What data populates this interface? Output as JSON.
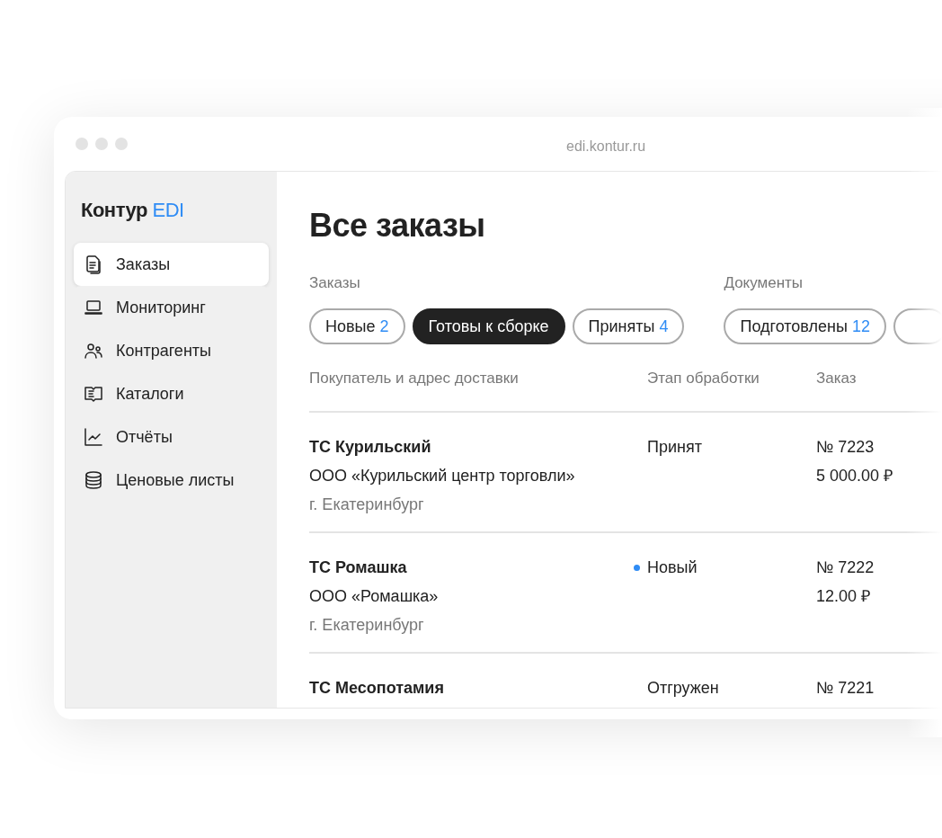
{
  "window": {
    "url": "edi.kontur.ru"
  },
  "sidebar": {
    "logo": {
      "name": "Контур",
      "product": "EDI"
    },
    "items": [
      {
        "label": "Заказы",
        "selected": true
      },
      {
        "label": "Мониторинг",
        "selected": false
      },
      {
        "label": "Контрагенты",
        "selected": false
      },
      {
        "label": "Каталоги",
        "selected": false
      },
      {
        "label": "Отчёты",
        "selected": false
      },
      {
        "label": "Ценовые листы",
        "selected": false
      }
    ]
  },
  "page_title": "Все заказы",
  "filter_groups": [
    {
      "label": "Заказы",
      "chips": [
        {
          "label": "Новые",
          "count": "2",
          "selected": false
        },
        {
          "label": "Готовы к сборке",
          "selected": true
        },
        {
          "label": "Приняты",
          "count": "4",
          "selected": false
        }
      ]
    },
    {
      "label": "Документы",
      "chips": [
        {
          "label": "Подготовлены",
          "count": "12",
          "selected": false
        }
      ]
    }
  ],
  "table": {
    "columns": [
      "Покупатель и адрес доставки",
      "Этап обработки",
      "Заказ"
    ],
    "rows": [
      {
        "buyer": "ТС Курильский",
        "company": "ООО «Курильский центр торговли»",
        "city": "г. Екатеринбург",
        "stage": "Принят",
        "marked": false,
        "number": "№ 7223",
        "amount": "5 000.00 ₽"
      },
      {
        "buyer": "ТС Ромашка",
        "company": "ООО «Ромашка»",
        "city": "г. Екатеринбург",
        "stage": "Новый",
        "marked": true,
        "number": "№ 7222",
        "amount": "12.00 ₽"
      },
      {
        "buyer": "ТС Месопотамия",
        "stage": "Отгружен",
        "marked": false,
        "number": "№ 7221"
      }
    ]
  }
}
